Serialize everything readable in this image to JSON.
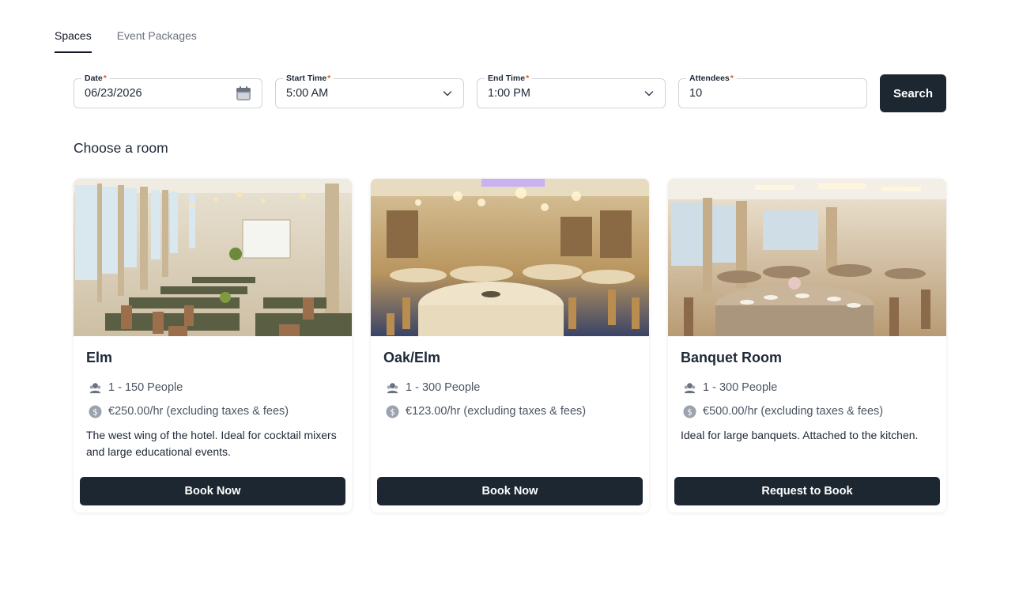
{
  "tabs": [
    {
      "label": "Spaces",
      "active": true
    },
    {
      "label": "Event Packages",
      "active": false
    }
  ],
  "search": {
    "date": {
      "label": "Date",
      "required_mark": "*",
      "value": "06/23/2026",
      "icon": "calendar-icon"
    },
    "start_time": {
      "label": "Start Time",
      "required_mark": "*",
      "value": "5:00 AM",
      "icon": "chevron-down-icon"
    },
    "end_time": {
      "label": "End Time",
      "required_mark": "*",
      "value": "1:00 PM",
      "icon": "chevron-down-icon"
    },
    "attendees": {
      "label": "Attendees",
      "required_mark": "*",
      "value": "10"
    },
    "button_label": "Search"
  },
  "section_title": "Choose a room",
  "rooms": [
    {
      "name": "Elm",
      "capacity": "1 - 150 People",
      "price": "€250.00/hr (excluding taxes & fees)",
      "description": "The west wing of the hotel. Ideal for cocktail mixers and large educational events.",
      "button_label": "Book Now",
      "image": "conference-room-photo"
    },
    {
      "name": "Oak/Elm",
      "capacity": "1 - 300 People",
      "price": "€123.00/hr (excluding taxes & fees)",
      "description": "",
      "button_label": "Book Now",
      "image": "ballroom-photo"
    },
    {
      "name": "Banquet Room",
      "capacity": "1 - 300 People",
      "price": "€500.00/hr (excluding taxes & fees)",
      "description": "Ideal for large banquets. Attached to the kitchen.",
      "button_label": "Request to Book",
      "image": "banquet-hall-photo"
    }
  ],
  "colors": {
    "primary_button": "#1d2731",
    "required_mark": "#e4572e",
    "border": "#cfd4da"
  }
}
